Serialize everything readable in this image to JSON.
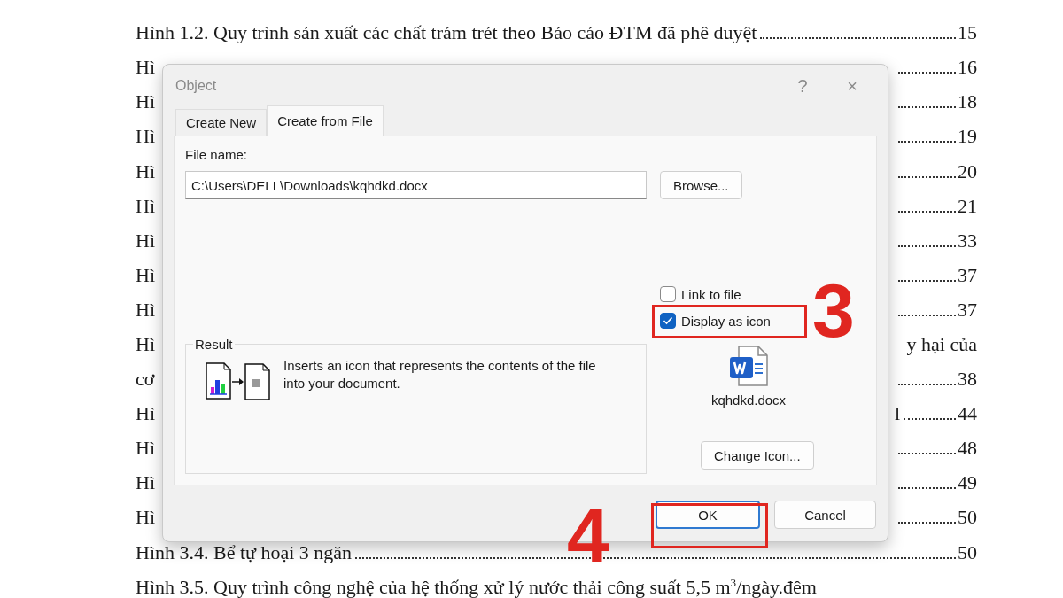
{
  "document": {
    "lines": [
      {
        "kind": "full",
        "text": "Hình 1.2. Quy trình sản xuất các chất trám trét theo Báo cáo ĐTM đã phê duyệt",
        "page": "15"
      },
      {
        "kind": "split",
        "left": "Hì",
        "page": "16"
      },
      {
        "kind": "split",
        "left": "Hì",
        "page": "18"
      },
      {
        "kind": "split",
        "left": "Hì",
        "page": "19"
      },
      {
        "kind": "split",
        "left": "Hì",
        "page": "20"
      },
      {
        "kind": "split",
        "left": "Hì",
        "page": "21"
      },
      {
        "kind": "split",
        "left": "Hì",
        "page": "33"
      },
      {
        "kind": "split",
        "left": "Hì",
        "page": "37"
      },
      {
        "kind": "split",
        "left": "Hì",
        "page": "37"
      },
      {
        "kind": "split",
        "left": "Hì",
        "right": "y hại của"
      },
      {
        "kind": "split",
        "left": "cơ",
        "page": "38"
      },
      {
        "kind": "split",
        "left": "Hì",
        "right": "l",
        "page": "44"
      },
      {
        "kind": "split",
        "left": "Hì",
        "page": "48"
      },
      {
        "kind": "split",
        "left": "Hì",
        "page": "49"
      },
      {
        "kind": "split",
        "left": "Hì",
        "page": "50"
      },
      {
        "kind": "full",
        "text": "Hình 3.4. Bể tự hoại 3 ngăn",
        "page": "50"
      },
      {
        "kind": "full",
        "text": "Hình 3.5. Quy trình công nghệ của hệ thống xử lý nước thải công suất 5,5 m$^{3}$/ngày.đêm"
      }
    ]
  },
  "dialog": {
    "title": "Object",
    "help": "?",
    "close": "×",
    "tabs": [
      {
        "label": "Create New",
        "selected": false
      },
      {
        "label": "Create from File",
        "selected": true
      }
    ],
    "file_name": {
      "label": "File name:",
      "value": "C:\\Users\\DELL\\Downloads\\kqhdkd.docx"
    },
    "browse": "Browse...",
    "options": [
      {
        "label": "Link to file",
        "checked": false
      },
      {
        "label": "Display as icon",
        "checked": true
      }
    ],
    "result": {
      "label": "Result",
      "text": "Inserts an icon that represents the contents of the file into your document."
    },
    "icon_caption": "kqhdkd.docx",
    "change_icon": "Change Icon...",
    "buttons": [
      {
        "label": "OK",
        "default": true
      },
      {
        "label": "Cancel",
        "default": false
      }
    ]
  },
  "annotations": [
    {
      "number": "3"
    },
    {
      "number": "4"
    }
  ]
}
